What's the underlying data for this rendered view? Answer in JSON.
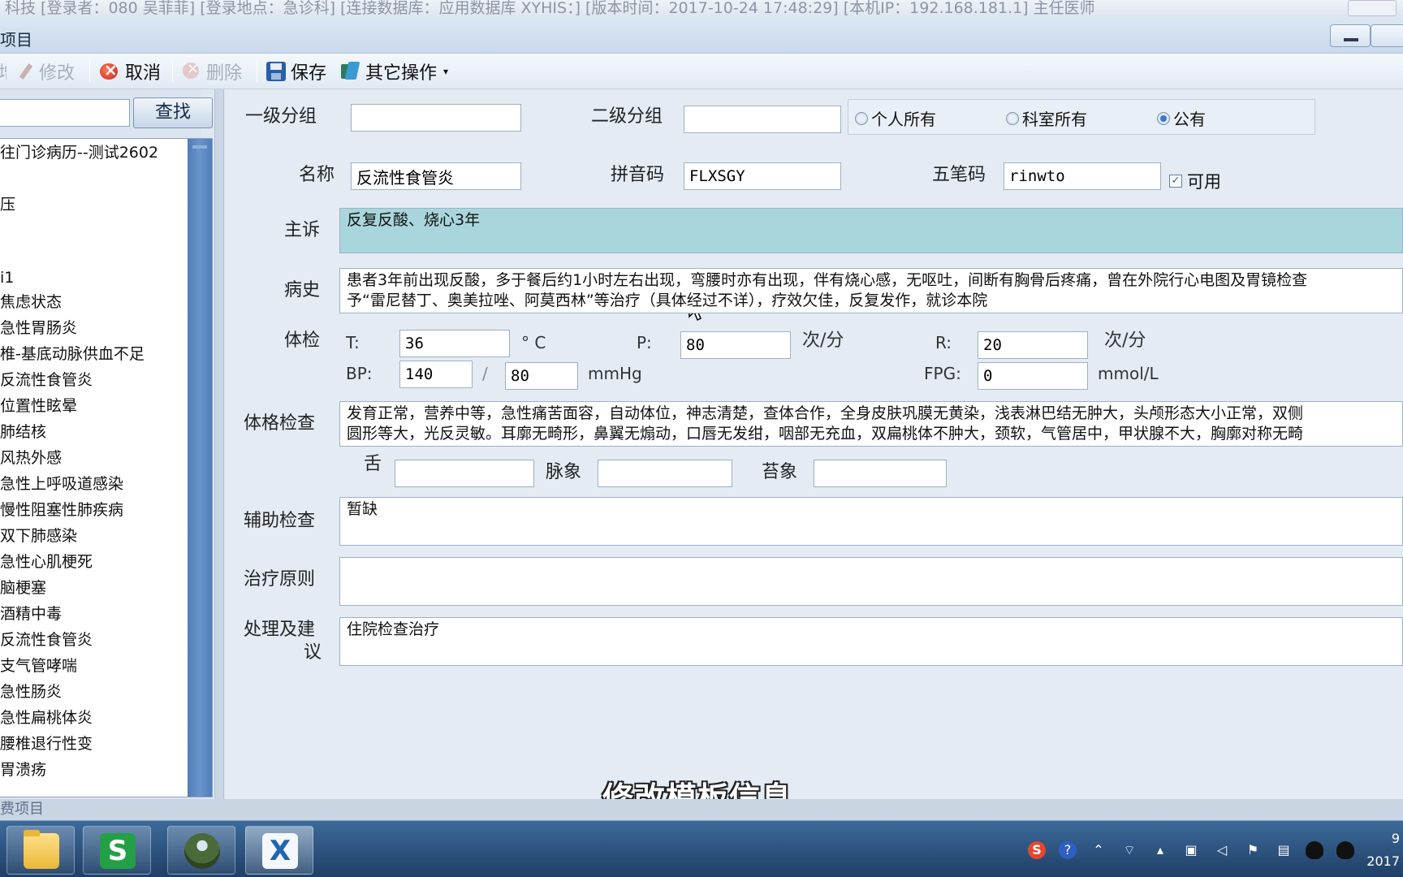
{
  "outer_title": "科技 [登录者：080 吴菲菲] [登录地点：急诊科] [连接数据库：应用数据库 XYHIS：] [版本时间：2017-10-24 17:48:29] [本机IP：192.168.181.1] 主任医师",
  "window": {
    "title": "项目"
  },
  "toolbar": {
    "new_fragment": "增",
    "edit_label": "修改",
    "cancel_label": "取消",
    "delete_label": "删除",
    "save_label": "保存",
    "other_label": "其它操作"
  },
  "sidebar": {
    "search_value": "",
    "find_label": "查找",
    "items": [
      "往门诊病历--测试2602",
      "",
      "压",
      "",
      "",
      "i1",
      "焦虑状态",
      "急性胃肠炎",
      "椎-基底动脉供血不足",
      "反流性食管炎",
      "位置性眩晕",
      "肺结核",
      "风热外感",
      "急性上呼吸道感染",
      "慢性阻塞性肺疾病",
      "双下肺感染",
      "急性心肌梗死",
      "脑梗塞",
      "酒精中毒",
      "反流性食管炎",
      "支气管哮喘",
      "急性肠炎",
      "急性扁桃体炎",
      "腰椎退行性变",
      "胃溃疡"
    ]
  },
  "form": {
    "group1_label": "一级分组",
    "group1_value": "",
    "group2_label": "二级分组",
    "group2_value": "",
    "ownership": {
      "personal": "个人所有",
      "department": "科室所有",
      "public": "公有",
      "selected": "公有"
    },
    "name_label": "名称",
    "name_value": "反流性食管炎",
    "pinyin_label": "拼音码",
    "pinyin_value": "FLXSGY",
    "wubi_label": "五笔码",
    "wubi_value": "rinwto",
    "enabled_label": "可用",
    "enabled_mark": "✓",
    "chief_complaint_label": "主诉",
    "chief_complaint_value": "反复反酸、烧心3年",
    "history_label": "病史",
    "history_line1": "患者3年前出现反酸，多于餐后约1小时左右出现，弯腰时亦有出现，伴有烧心感，无呕吐，间断有胸骨后疼痛，曾在外院行心电图及胃镜检查",
    "history_line2": "予“雷尼替丁、奥美拉唑、阿莫西林”等治疗（具体经过不详），疗效欠佳，反复发作，就诊本院",
    "vitals_label": "体检",
    "t_label": "T:",
    "t_value": "36",
    "t_unit": "° C",
    "p_label": "P:",
    "p_value": "80",
    "p_unit": "次/分",
    "r_label": "R:",
    "r_value": "20",
    "r_unit": "次/分",
    "bp_label": "BP:",
    "bp_sys": "140",
    "bp_sep": "/",
    "bp_dia": "80",
    "bp_unit": "mmHg",
    "fpg_label": "FPG:",
    "fpg_value": "0",
    "fpg_unit": "mmol/L",
    "physical_label": "体格检查",
    "physical_line1": "发育正常，营养中等，急性痛苦面容，自动体位，神志清楚，查体合作，全身皮肤巩膜无黄染，浅表淋巴结无肿大，头颅形态大小正常，双侧",
    "physical_line2": "圆形等大，光反灵敏。耳廓无畸形，鼻翼无煽动，口唇无发绀，咽部无充血，双扁桃体不肿大，颈软，气管居中，甲状腺不大，胸廓对称无畸",
    "tongue_label": "舌",
    "tongue_value": "",
    "pulse_label": "脉象",
    "pulse_value": "",
    "coating_label": "苔象",
    "coating_value": "",
    "aux_label": "辅助检查",
    "aux_value": "暂缺",
    "treatment_label": "治疗原则",
    "treatment_value": "",
    "advice_label_1": "处理及建",
    "advice_label_2": "议",
    "advice_value": "住院检查治疗"
  },
  "subtitle": "修改模板信息",
  "status_strip": "费项目",
  "taskbar": {
    "wps_glyph": "S",
    "x_glyph": "X",
    "tray": {
      "sogou": "S",
      "help": "?"
    },
    "clock_line1": "9",
    "clock_line2": "2017"
  }
}
